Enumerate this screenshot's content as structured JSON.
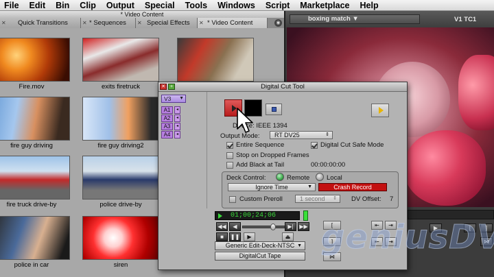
{
  "menu": [
    "File",
    "Edit",
    "Bin",
    "Clip",
    "Output",
    "Special",
    "Tools",
    "Windows",
    "Script",
    "Marketplace",
    "Help"
  ],
  "bin": {
    "title": "* Video Content",
    "tabs": [
      "Quick Transitions",
      "* Sequences",
      "Special Effects",
      "* Video Content"
    ],
    "clips": [
      "Fire.mov",
      "exits firetruck",
      "",
      "fire guy driving",
      "fire guy driving2",
      "",
      "fire truck drive-by",
      "police drive-by",
      "",
      "police in car",
      "siren",
      ""
    ]
  },
  "monitor": {
    "sequence": "boxing match",
    "track": "V1",
    "tc_label": "TC1"
  },
  "digital_cut": {
    "title": "Digital Cut Tool",
    "track_menu": "V3",
    "tracks": [
      "A1",
      "A2",
      "A3",
      "A4"
    ],
    "device_label": "Device: IEEE 1394",
    "output_mode_label": "Output Mode:",
    "output_mode_value": "RT DV25",
    "entire_sequence": "Entire Sequence",
    "safe_mode": "Digital Cut Safe Mode",
    "stop_on_dropped": "Stop on Dropped Frames",
    "add_black": "Add Black at Tail",
    "black_duration": "00:00:00:00",
    "deck_control_label": "Deck Control:",
    "deck_remote": "Remote",
    "deck_local": "Local",
    "ignore_time": "Ignore Time",
    "crash_record": "Crash Record",
    "custom_preroll": "Custom Preroll",
    "preroll_value": "1 second",
    "dv_offset_label": "DV Offset:",
    "dv_offset_value": "7",
    "timecode": "01;00;24;06",
    "deck_profile": "Generic Edit-Deck-NTSC",
    "tape_name": "DigitalCut Tape",
    "settings": {
      "entire_sequence": true,
      "safe_mode": true,
      "stop_on_dropped": false,
      "add_black": false,
      "deck_remote": true,
      "custom_preroll": false
    }
  },
  "watermark": "geniusDV",
  "colors": {
    "crash": "#c31010",
    "record_btn": "#d63a3a",
    "timecode_green": "#3ad83a"
  }
}
